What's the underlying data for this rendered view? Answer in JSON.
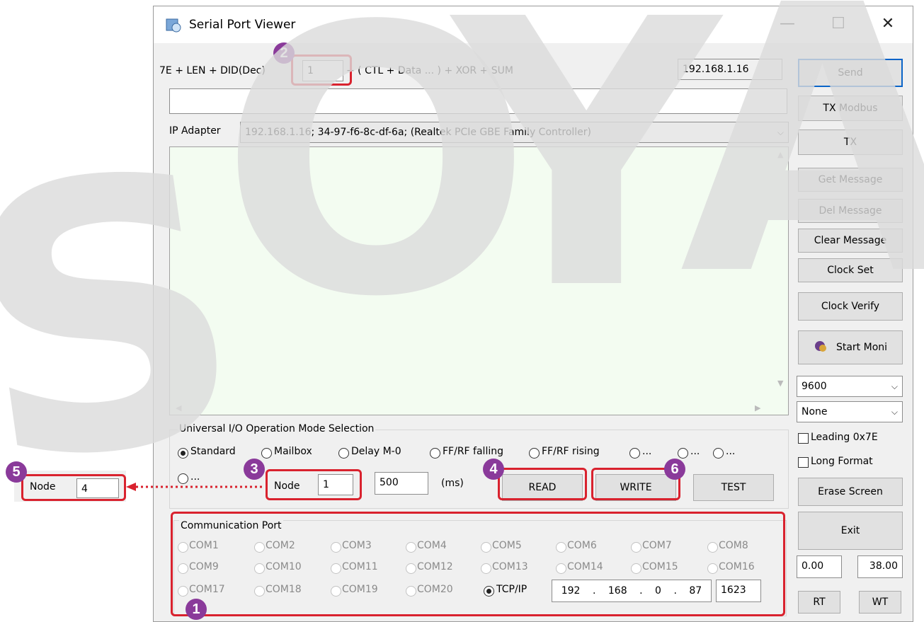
{
  "window": {
    "title": "Serial Port Viewer",
    "minimize": "—",
    "maximize": "☐",
    "close": "✕"
  },
  "watermark": {
    "text": "SOYAL"
  },
  "top_row": {
    "prefix": "7E + LEN + DID(Dec)",
    "did_value": "1",
    "suffix": "+ ( CTL + Data ... ) + XOR + SUM",
    "ip_display": "192.168.1.16"
  },
  "command_input": {
    "value": ""
  },
  "ip_adapter": {
    "label": "IP Adapter",
    "value": "192.168.1.16;  34-97-f6-8c-df-6a;  (Realtek PCIe GBE Family Controller)"
  },
  "right_buttons": {
    "send": "Send",
    "tx_modbus": "TX Modbus",
    "tx": "TX",
    "get_message": "Get Message",
    "del_message": "Del Message",
    "clear_message": "Clear Message",
    "clock_set": "Clock Set",
    "clock_verify": "Clock Verify",
    "start_moni": "Start Moni",
    "erase_screen": "Erase Screen",
    "exit": "Exit",
    "rt": "RT",
    "wt": "WT"
  },
  "baud_select": {
    "value": "9600"
  },
  "parity_select": {
    "value": "None"
  },
  "options": {
    "leading": "Leading 0x7E",
    "long_format": "Long Format"
  },
  "timings": {
    "left": "0.00",
    "right": "38.00"
  },
  "io_mode": {
    "title": "Universal I/O Operation Mode Selection",
    "radios": [
      "Standard",
      "Mailbox",
      "Delay M-0",
      "FF/RF falling",
      "FF/RF rising",
      "...",
      "...",
      "...",
      "..."
    ],
    "node_label": "Node",
    "node_value": "1",
    "ms_value": "500",
    "ms_unit": "(ms)",
    "read": "READ",
    "write": "WRITE",
    "test": "TEST"
  },
  "comm_port": {
    "title": "Communication Port",
    "ports": [
      "COM1",
      "COM2",
      "COM3",
      "COM4",
      "COM5",
      "COM6",
      "COM7",
      "COM8",
      "COM9",
      "COM10",
      "COM11",
      "COM12",
      "COM13",
      "COM14",
      "COM15",
      "COM16",
      "COM17",
      "COM18",
      "COM19",
      "COM20"
    ],
    "tcp_label": "TCP/IP",
    "ip": [
      "192",
      "168",
      "0",
      "87"
    ],
    "port": "1623"
  },
  "callout": {
    "node_label": "Node",
    "node_value": "4"
  },
  "badges": [
    "1",
    "2",
    "3",
    "4",
    "5",
    "6"
  ],
  "colors": {
    "highlight": "#d9222e",
    "badge": "#8a3a9a",
    "log_bg": "#f3fcf1",
    "accent_border": "#0a64c8"
  }
}
